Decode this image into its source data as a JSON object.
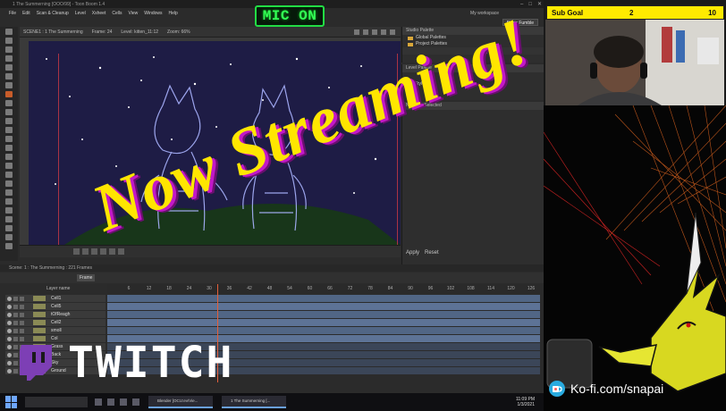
{
  "app": {
    "title": "1 The Summerning [OOO/99] - Toon Boom 1.4",
    "menu": [
      "File",
      "Edit",
      "Scan & Cleanup",
      "Level",
      "Xsheet",
      "Cells",
      "View",
      "Windows",
      "Help"
    ],
    "workspace": "My workspace",
    "room": "Basic Fumble"
  },
  "viewer": {
    "tab_info": "SCENE1 : 1 The Summerning",
    "frame_info": "Frame: 24",
    "level_info": "Level: kitten_11:12",
    "zoom": "Zoom: 66%"
  },
  "right_panel": {
    "studio_palette_title": "Studio Palette",
    "palettes": [
      "Global Palettes",
      "Project Palettes"
    ],
    "level_palette_title": "Level Palette",
    "no_styles": "No Styles",
    "style_selected": "No Style Selected",
    "apply_label": "Apply",
    "reset_label": "Reset"
  },
  "timeline": {
    "header": "Scene: 1 : The Summerning : 221 Frames",
    "frame_field": "Frame",
    "layer_column_title": "Layer name",
    "ruler_ticks": [
      "6",
      "12",
      "18",
      "24",
      "30",
      "36",
      "42",
      "48",
      "54",
      "60",
      "66",
      "72",
      "78",
      "84",
      "90",
      "96",
      "102",
      "108",
      "114",
      "120",
      "126"
    ],
    "layers": [
      {
        "name": "Cell1"
      },
      {
        "name": "Cell5"
      },
      {
        "name": "tOfReagh"
      },
      {
        "name": "Cell2"
      },
      {
        "name": "smoll"
      },
      {
        "name": "Col"
      },
      {
        "name": "Grass"
      },
      {
        "name": "Back"
      },
      {
        "name": "Sky"
      },
      {
        "name": "Ground"
      }
    ]
  },
  "taskbar": {
    "task_1": "Blender [OCU:ev/Vie...",
    "task_2": "1 The Summerning [...",
    "time": "11:09 PM",
    "date": "1/3/2021"
  },
  "overlay": {
    "mic_status": "MIC ON",
    "headline": "Now Streaming!",
    "platform": "TWITCH",
    "sub_goal_label": "Sub Goal",
    "sub_goal_current": "2",
    "sub_goal_target": "10",
    "kofi": "Ko-fi.com/snapai"
  },
  "colors": {
    "mic_green": "#22dd44",
    "headline_yellow": "#ffe600",
    "headline_shadow": "#c218c8",
    "subgoal_bg": "#ffea00",
    "canvas_bg": "#1e1c45",
    "twitch_purple": "#7d3fb5"
  }
}
